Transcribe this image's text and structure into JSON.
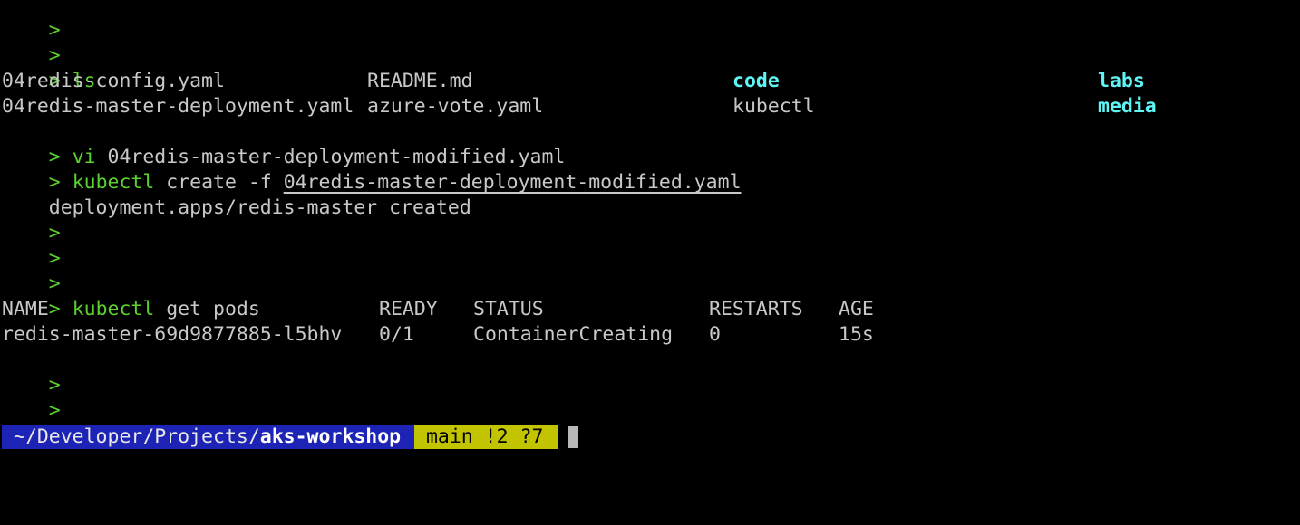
{
  "prompt_symbol": ">",
  "lines": [
    {
      "type": "prompt",
      "cmd": ""
    },
    {
      "type": "prompt",
      "cmd": ""
    },
    {
      "type": "prompt",
      "cmd": "ls"
    },
    {
      "type": "ls_row",
      "cols": [
        "04redis-config.yaml",
        "README.md",
        "code",
        "labs"
      ]
    },
    {
      "type": "ls_row",
      "cols": [
        "04redis-master-deployment.yaml",
        "azure-vote.yaml",
        "kubectl",
        "media"
      ]
    },
    {
      "type": "prompt",
      "cmd": "vi",
      "args": " 04redis-master-deployment-modified.yaml"
    },
    {
      "type": "prompt",
      "cmd": "kubectl",
      "args": " create -f ",
      "file": "04redis-master-deployment-modified.yaml"
    },
    {
      "type": "output",
      "text": "deployment.apps/redis-master created"
    },
    {
      "type": "prompt",
      "cmd": ""
    },
    {
      "type": "prompt",
      "cmd": ""
    },
    {
      "type": "prompt",
      "cmd": ""
    },
    {
      "type": "prompt",
      "cmd": "kubectl",
      "args": " get pods"
    },
    {
      "type": "table_header",
      "cols": [
        "NAME",
        "READY",
        "STATUS",
        "RESTARTS",
        "AGE"
      ]
    },
    {
      "type": "table_row",
      "cols": [
        "redis-master-69d9877885-l5bhv",
        "0/1",
        "ContainerCreating",
        "0",
        "15s"
      ]
    },
    {
      "type": "prompt",
      "cmd": ""
    },
    {
      "type": "prompt",
      "cmd": ""
    },
    {
      "type": "prompt",
      "cmd": ""
    }
  ],
  "status_bar": {
    "path_prefix": " ~/Developer/Projects/",
    "path_current": "aks-workshop",
    "git_branch": " main !2 ?7"
  },
  "colors": {
    "prompt_green": "#5bd02e",
    "directory_cyan": "#60f5f5",
    "path_blue": "#1d23b4",
    "git_yellow": "#c3c400"
  }
}
